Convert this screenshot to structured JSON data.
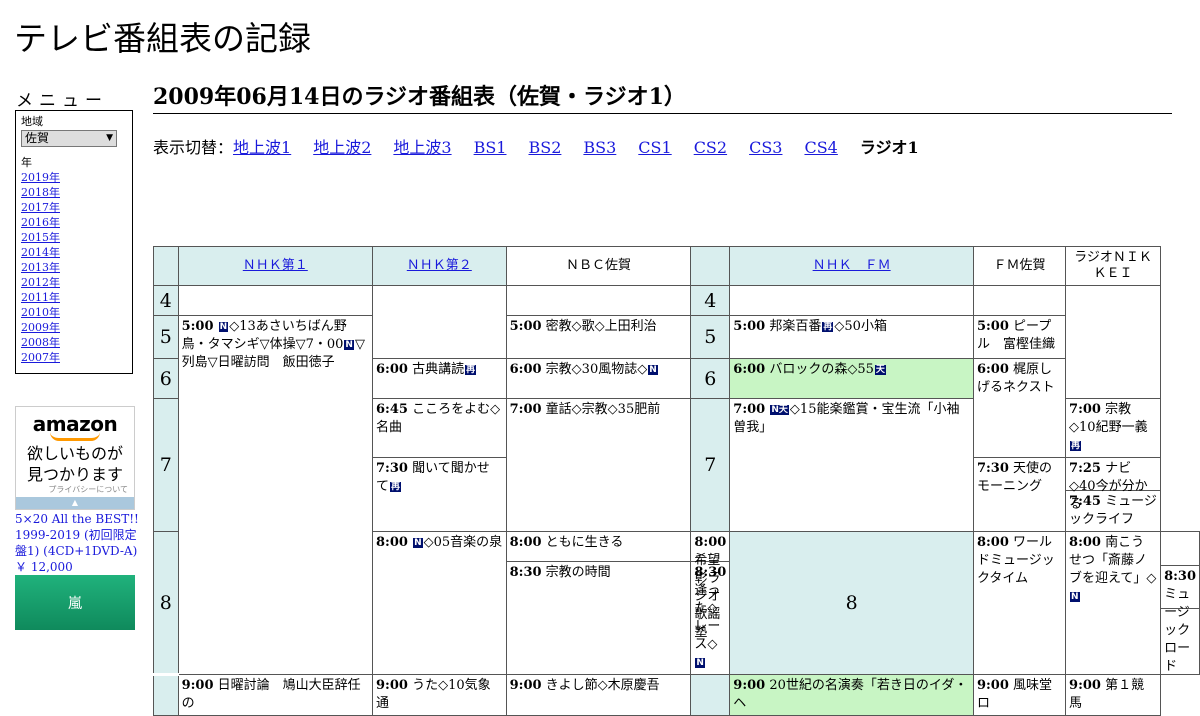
{
  "site": {
    "title": "テレビ番組表の記録"
  },
  "menu": {
    "title": "メニュー",
    "region_label": "地域",
    "region_value": "佐賀",
    "year_label": "年",
    "years": [
      "2019年",
      "2018年",
      "2017年",
      "2016年",
      "2015年",
      "2014年",
      "2013年",
      "2012年",
      "2011年",
      "2010年",
      "2009年",
      "2008年",
      "2007年"
    ]
  },
  "ad": {
    "brand": "amazon",
    "line1": "欲しいものが",
    "line2": "見つかります",
    "privacy": "プライバシーについて",
    "product_title": "5×20 All the BEST!! 1999-2019 (初回限定盤1) (4CD+1DVD-A)",
    "price": "￥ 12,000",
    "image_text": "嵐"
  },
  "page": {
    "heading": "2009年06月14日のラジオ番組表（佐賀・ラジオ1）"
  },
  "switcher": {
    "label": "表示切替：",
    "links": [
      "地上波1",
      "地上波2",
      "地上波3",
      "BS1",
      "BS2",
      "BS3",
      "CS1",
      "CS2",
      "CS3",
      "CS4"
    ],
    "current": "ラジオ1"
  },
  "grid": {
    "channels": [
      "ＮＨＫ第１",
      "ＮＨＫ第２",
      "ＮＢＣ佐賀",
      "ＮＨＫ　ＦＭ",
      "ＦＭ佐賀",
      "ラジオＮＩＫＫＥＩ"
    ],
    "hours": [
      "4",
      "5",
      "6",
      "7",
      "8"
    ],
    "programs": {
      "nhk1_500": {
        "time": "5:00",
        "badge": "N",
        "text": "◇13あさいちばん野鳥・タマシギ▽体操▽7・00",
        "badge2": "N",
        "text2": "▽列島▽日曜訪問　飯田徳子"
      },
      "nhk1_800": {
        "time": "8:00",
        "badge": "N",
        "text": "◇05音楽の泉"
      },
      "nhk1_900": {
        "time": "9:00",
        "text": "日曜討論　鳩山大臣辞任の"
      },
      "nhk2_600": {
        "time": "6:00",
        "text": "古典講読",
        "badge": "再"
      },
      "nhk2_645": {
        "time": "6:45",
        "text": "こころをよむ◇名曲"
      },
      "nhk2_730": {
        "time": "7:30",
        "text": "聞いて聞かせて",
        "badge": "再"
      },
      "nhk2_800": {
        "time": "8:00",
        "text": "ともに生きる"
      },
      "nhk2_830": {
        "time": "8:30",
        "text": "宗教の時間"
      },
      "nhk2_900": {
        "time": "9:00",
        "text": "うた◇10気象通"
      },
      "nbc_500": {
        "time": "5:00",
        "text": "密教◇歌◇上田利治"
      },
      "nbc_600": {
        "time": "6:00",
        "text": "宗教◇30風物誌◇",
        "badge": "N"
      },
      "nbc_700": {
        "time": "7:00",
        "text": "童話◇宗教◇35肥前"
      },
      "nbc_800": {
        "time": "8:00",
        "text": "希望彰ラジオ歌謡塾"
      },
      "nbc_830": {
        "time": "8:30",
        "text": "逢った◇レース◇",
        "badge": "N"
      },
      "nbc_900": {
        "time": "9:00",
        "text": "きよし節◇木原慶吾"
      },
      "fm_500": {
        "time": "5:00",
        "text": "邦楽百番",
        "badge": "再",
        "text2": "◇50小箱"
      },
      "fm_600": {
        "time": "6:00",
        "text": "バロックの森◇55",
        "badge": "天"
      },
      "fm_700": {
        "time": "7:00",
        "badge": "N天",
        "text": "◇15能楽鑑賞・宝生流「小袖曽我」"
      },
      "fm_800": {
        "time": "8:00",
        "text": "ワールドミュージックタイム"
      },
      "fm_900": {
        "time": "9:00",
        "text": "20世紀の名演奏「若き日のイダ・ヘ"
      },
      "fmsaga_500": {
        "time": "5:00",
        "text": "ピープル　富樫佳織"
      },
      "fmsaga_600": {
        "time": "6:00",
        "text": "梶原しげるネクスト"
      },
      "fmsaga_730": {
        "time": "7:30",
        "text": "天使のモーニング"
      },
      "fmsaga_800": {
        "time": "8:00",
        "text": "南こうせつ「斎藤ノブを迎えて」◇",
        "badge": "N"
      },
      "fmsaga_900": {
        "time": "9:00",
        "text": "風味堂ロ"
      },
      "nikkei_700": {
        "time": "7:00",
        "text": "宗教◇10紀野一義",
        "badge": "再"
      },
      "nikkei_725": {
        "time": "7:25",
        "text": "ナビ◇40今が分かる"
      },
      "nikkei_745": {
        "time": "7:45",
        "text": "ミュージックライフ"
      },
      "nikkei_830": {
        "time": "8:30",
        "text": "ミュージックロード"
      },
      "nikkei_900": {
        "time": "9:00",
        "text": "第１競馬"
      }
    }
  }
}
